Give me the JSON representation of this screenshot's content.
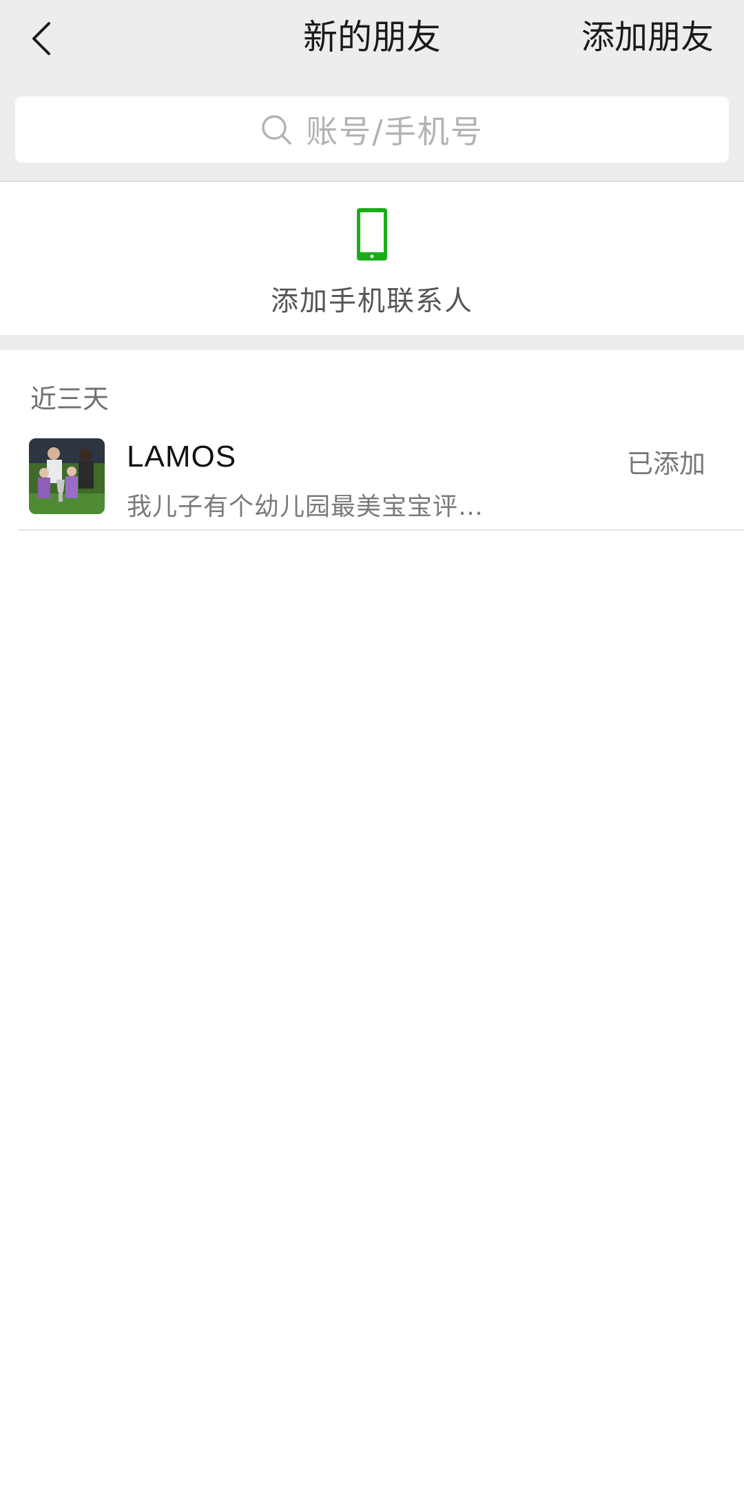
{
  "navbar": {
    "back_icon": "chevron-left-icon",
    "title": "新的朋友",
    "action_label": "添加朋友"
  },
  "search": {
    "icon": "search-icon",
    "placeholder": "账号/手机号"
  },
  "add_contacts": {
    "icon": "mobile-phone-icon",
    "icon_color": "#1aad19",
    "label": "添加手机联系人"
  },
  "recent": {
    "section_label": "近三天",
    "items": [
      {
        "name": "LAMOS",
        "message": "我儿子有个幼儿园最美宝宝评…",
        "status": "已添加"
      }
    ]
  }
}
